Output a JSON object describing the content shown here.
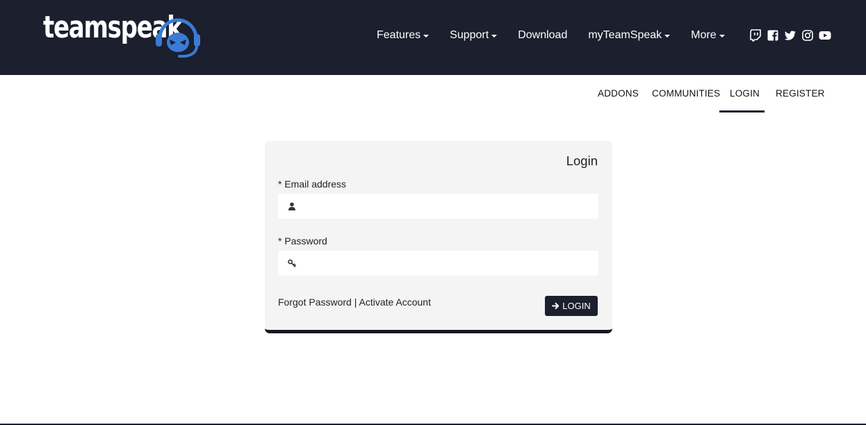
{
  "brand": {
    "name": "teamspeak",
    "logo_icon": "headset-logo-icon",
    "accent": "#3a7bd5"
  },
  "nav": {
    "items": [
      {
        "label": "Features",
        "dropdown": true
      },
      {
        "label": "Support",
        "dropdown": true
      },
      {
        "label": "Download",
        "dropdown": false
      },
      {
        "label": "myTeamSpeak",
        "dropdown": true
      },
      {
        "label": "More",
        "dropdown": true
      }
    ],
    "socials": [
      "twitch-icon",
      "facebook-icon",
      "twitter-icon",
      "instagram-icon",
      "youtube-icon"
    ]
  },
  "subnav": {
    "items": [
      "ADDONS",
      "COMMUNITIES",
      "LOGIN",
      "REGISTER"
    ],
    "active": "LOGIN"
  },
  "login": {
    "title": "Login",
    "email": {
      "label": "* Email address",
      "value": "",
      "placeholder": "",
      "icon": "user-icon"
    },
    "password": {
      "label": "* Password",
      "value": "",
      "placeholder": "",
      "icon": "key-icon"
    },
    "forgot": "Forgot Password",
    "separator": "|",
    "activate": "Activate Account",
    "button": "LOGIN",
    "button_icon": "arrow-right-icon"
  },
  "colors": {
    "header_bg": "#1b1f2e",
    "card_bg": "#f4f4f4",
    "page_bg": "#ffffff"
  }
}
